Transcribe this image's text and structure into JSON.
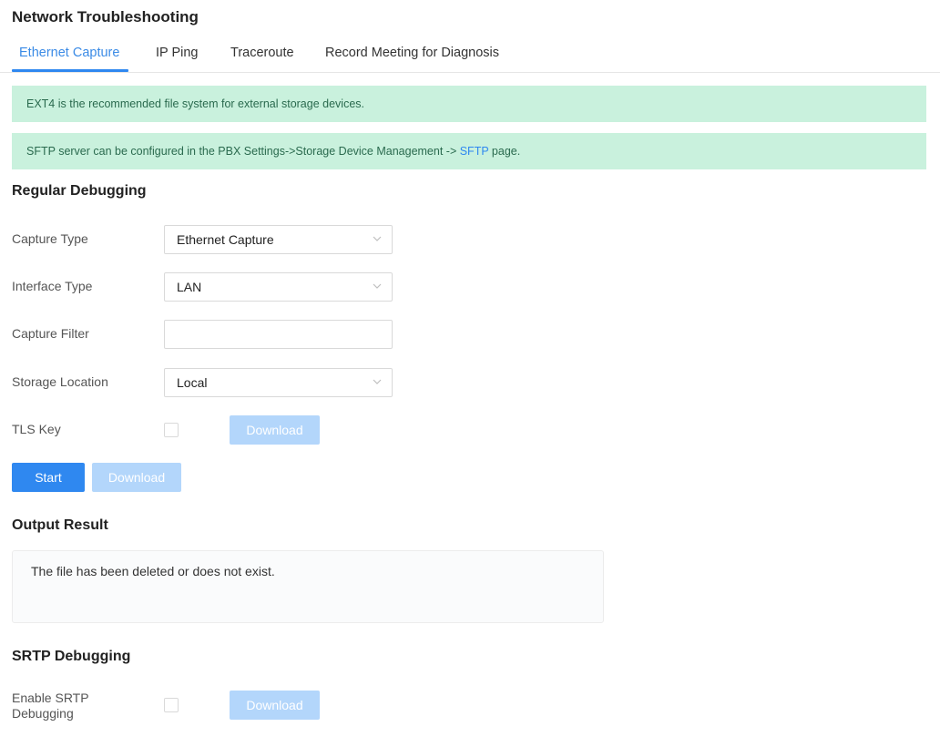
{
  "page": {
    "title": "Network Troubleshooting"
  },
  "tabs": [
    {
      "label": "Ethernet Capture",
      "active": true
    },
    {
      "label": "IP Ping",
      "active": false
    },
    {
      "label": "Traceroute",
      "active": false
    },
    {
      "label": "Record Meeting for Diagnosis",
      "active": false
    }
  ],
  "notices": {
    "storage": "EXT4 is the recommended file system for external storage devices.",
    "sftp_prefix": "SFTP server can be configured in the PBX Settings->Storage Device Management -> ",
    "sftp_link": "SFTP",
    "sftp_suffix": " page."
  },
  "regular": {
    "title": "Regular Debugging",
    "capture_type": {
      "label": "Capture Type",
      "value": "Ethernet Capture"
    },
    "interface_type": {
      "label": "Interface Type",
      "value": "LAN"
    },
    "capture_filter": {
      "label": "Capture Filter",
      "value": "",
      "placeholder": ""
    },
    "storage_location": {
      "label": "Storage Location",
      "value": "Local"
    },
    "tls_key": {
      "label": "TLS Key",
      "checked": false,
      "download_label": "Download"
    },
    "start_label": "Start",
    "download_label": "Download"
  },
  "output": {
    "title": "Output Result",
    "text": "The file has been deleted or does not exist."
  },
  "srtp": {
    "title": "SRTP Debugging",
    "enable_label_line1": "Enable SRTP",
    "enable_label_line2": "Debugging",
    "checked": false,
    "download_label": "Download"
  },
  "colors": {
    "accent": "#2f88f0",
    "accent_disabled": "#b3d6fb",
    "notice_bg": "#c9f1dd",
    "notice_text": "#2a6a4e"
  }
}
